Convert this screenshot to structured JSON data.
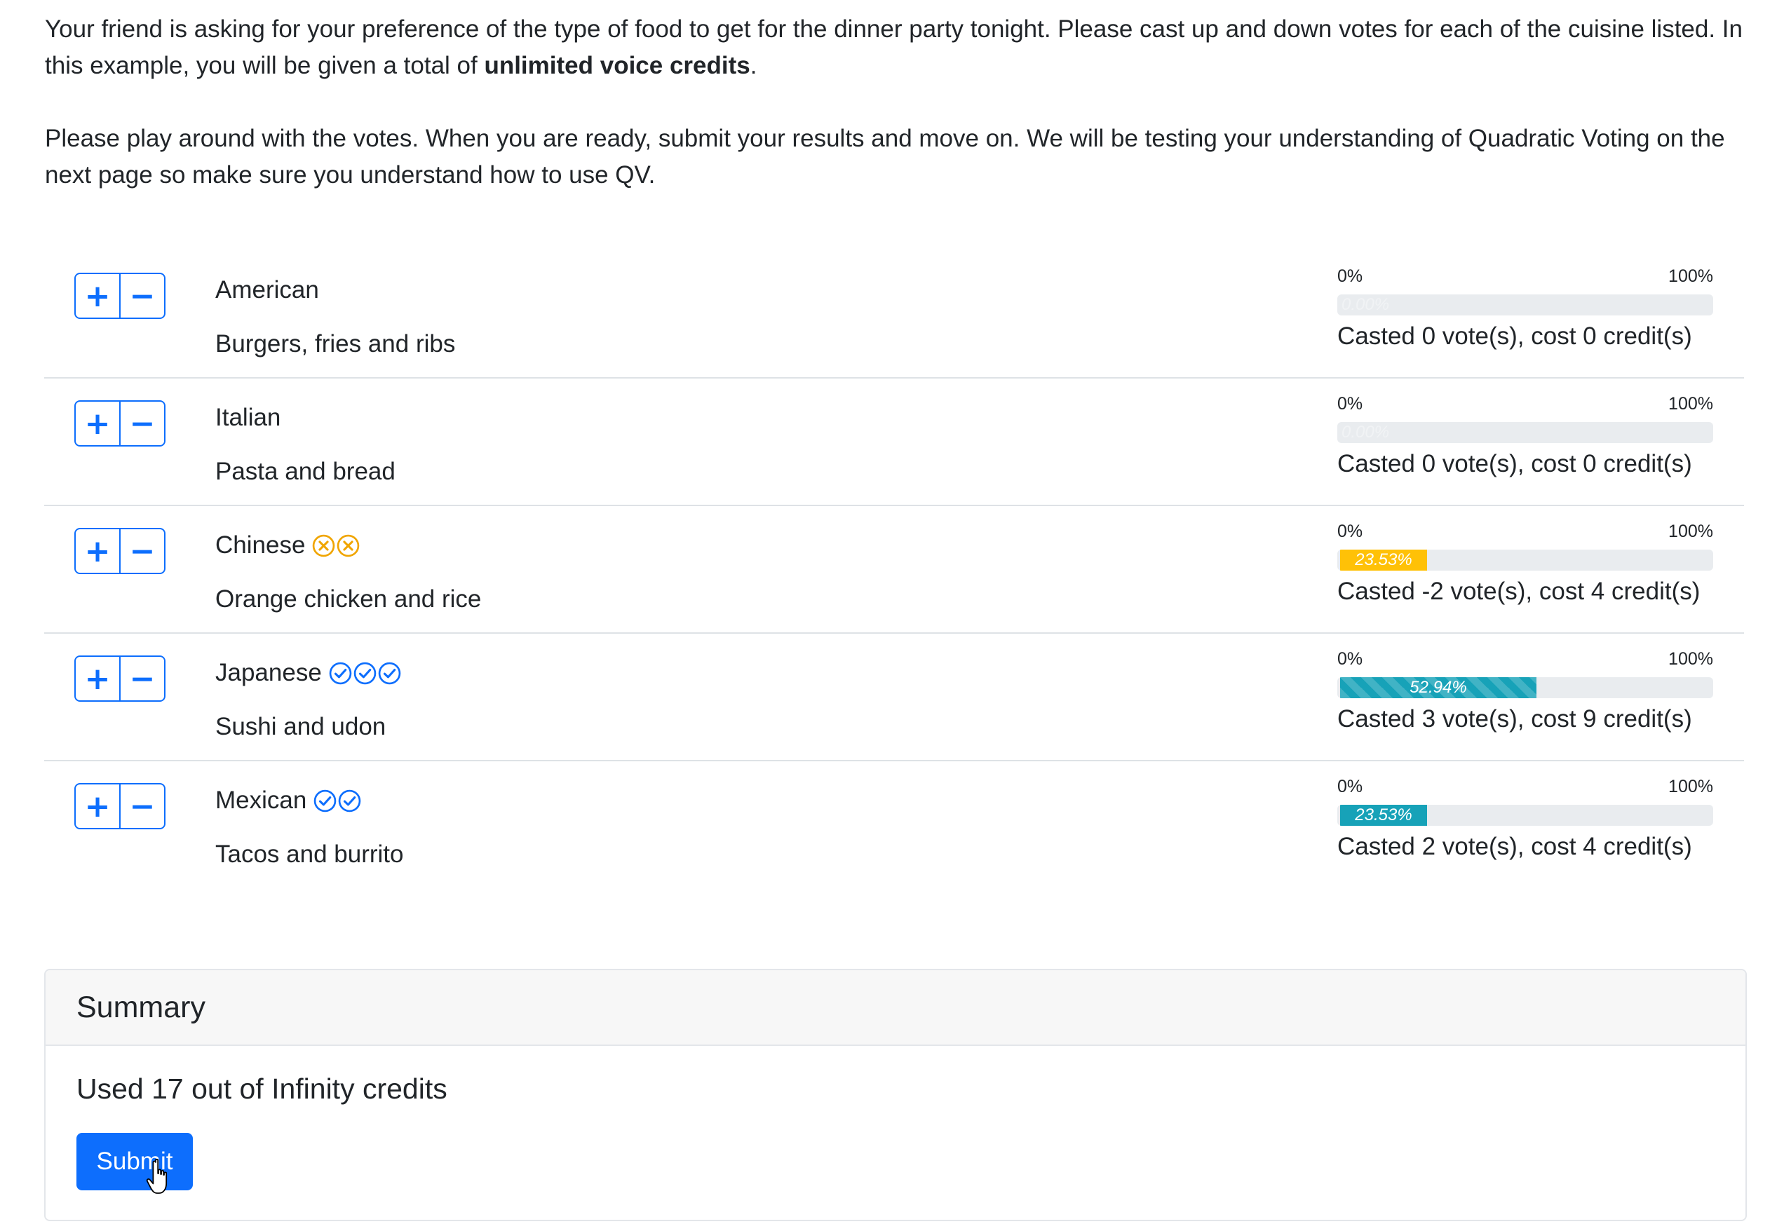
{
  "intro": {
    "p1_text": "Your friend is asking for your preference of the type of food to get for the dinner party tonight. Please cast up and down votes for each of the cuisine listed. In this example, you will be given a total of ",
    "p1_bold": "unlimited voice credits",
    "p1_end": ".",
    "p2": "Please play around with the votes. When you are ready, submit your results and move on. We will be testing your understanding of Quadratic Voting on the next page so make sure you understand how to use QV."
  },
  "vote_buttons": {
    "plus": "+",
    "minus": "−"
  },
  "progress_scale": {
    "min": "0%",
    "max": "100%"
  },
  "colors": {
    "primary": "#0d6efd",
    "info": "#17a2b8",
    "warning": "#ffc107",
    "down_icon": "#f0a500",
    "up_icon": "#0d6efd"
  },
  "items": [
    {
      "name": "American",
      "desc": "Burgers, fries and ribs",
      "votes": 0,
      "icon": "",
      "percent_label": "0.00%",
      "percent": 0,
      "bar_style": "zero",
      "cast": "Casted 0 vote(s), cost 0 credit(s)"
    },
    {
      "name": "Italian",
      "desc": "Pasta and bread",
      "votes": 0,
      "icon": "",
      "percent_label": "0.00%",
      "percent": 0,
      "bar_style": "zero",
      "cast": "Casted 0 vote(s), cost 0 credit(s)"
    },
    {
      "name": "Chinese",
      "desc": "Orange chicken and rice",
      "votes": -2,
      "icon": "x-circle-icon",
      "percent_label": "23.53%",
      "percent": 23.53,
      "bar_style": "yellow",
      "cast": "Casted -2 vote(s), cost 4 credit(s)"
    },
    {
      "name": "Japanese",
      "desc": "Sushi and udon",
      "votes": 3,
      "icon": "check-circle-icon",
      "percent_label": "52.94%",
      "percent": 52.94,
      "bar_style": "striped",
      "cast": "Casted 3 vote(s), cost 9 credit(s)"
    },
    {
      "name": "Mexican",
      "desc": "Tacos and burrito",
      "votes": 2,
      "icon": "check-circle-icon",
      "percent_label": "23.53%",
      "percent": 23.53,
      "bar_style": "info",
      "cast": "Casted 2 vote(s), cost 4 credit(s)"
    }
  ],
  "summary": {
    "title": "Summary",
    "used": "Used 17 out of Infinity credits",
    "submit_label": "Submit"
  }
}
